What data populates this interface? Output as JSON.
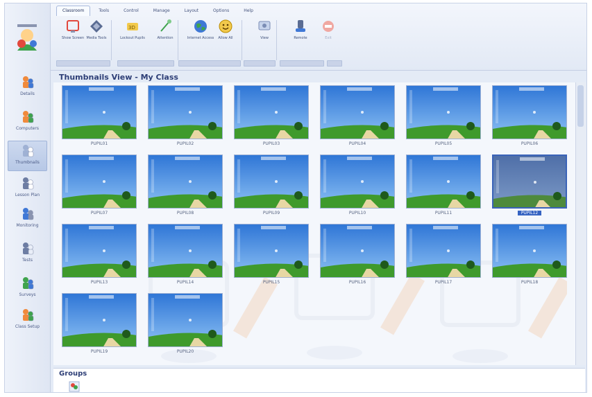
{
  "ribbon": {
    "tabs": [
      {
        "label": "Classroom",
        "active": true
      },
      {
        "label": "Tools",
        "active": false
      },
      {
        "label": "Control",
        "active": false
      },
      {
        "label": "Manage",
        "active": false
      },
      {
        "label": "Layout",
        "active": false
      },
      {
        "label": "Options",
        "active": false
      },
      {
        "label": "Help",
        "active": false
      }
    ],
    "buttons": [
      {
        "label": "Show Screen",
        "icon": "screen-icon"
      },
      {
        "label": "Media Tools",
        "icon": "media-icon"
      },
      {
        "label": "Lockout Pupils",
        "icon": "lock-icon"
      },
      {
        "label": "Attention",
        "icon": "attention-icon"
      },
      {
        "label": "Internet Access",
        "icon": "globe-icon"
      },
      {
        "label": "Allow All",
        "icon": "smiley-icon"
      },
      {
        "label": "View",
        "icon": "view-icon"
      },
      {
        "label": "Remote",
        "icon": "remote-icon"
      },
      {
        "label": "Exit",
        "icon": "stop-icon",
        "disabled": true
      }
    ]
  },
  "sidebar": {
    "items": [
      {
        "label": "Details",
        "icon": "details-icon"
      },
      {
        "label": "Computers",
        "icon": "computers-icon"
      },
      {
        "label": "Thumbnails",
        "icon": "thumbnails-icon",
        "active": true
      },
      {
        "label": "Lesson Plan",
        "icon": "lesson-plan-icon"
      },
      {
        "label": "Monitoring",
        "icon": "monitoring-icon"
      },
      {
        "label": "Tests",
        "icon": "tests-icon"
      },
      {
        "label": "Surveys",
        "icon": "surveys-icon"
      },
      {
        "label": "Class Setup",
        "icon": "class-setup-icon"
      }
    ]
  },
  "main": {
    "title": "Thumbnails View - My Class",
    "thumbnails": [
      {
        "label": "PUPIL01"
      },
      {
        "label": "PUPIL02"
      },
      {
        "label": "PUPIL03"
      },
      {
        "label": "PUPIL04"
      },
      {
        "label": "PUPIL05"
      },
      {
        "label": "PUPIL06"
      },
      {
        "label": "PUPIL07"
      },
      {
        "label": "PUPIL08"
      },
      {
        "label": "PUPIL09"
      },
      {
        "label": "PUPIL10"
      },
      {
        "label": "PUPIL11"
      },
      {
        "label": "PUPIL12",
        "selected": true
      },
      {
        "label": "PUPIL13"
      },
      {
        "label": "PUPIL14"
      },
      {
        "label": "PUPIL15"
      },
      {
        "label": "PUPIL16"
      },
      {
        "label": "PUPIL17"
      },
      {
        "label": "PUPIL18"
      },
      {
        "label": "PUPIL19"
      },
      {
        "label": "PUPIL20"
      }
    ]
  },
  "groups": {
    "title": "Groups"
  },
  "colors": {
    "accent": "#3563c2",
    "title": "#2d3e76",
    "sky": "#3d7ad0",
    "grass": "#3f9a2c"
  }
}
